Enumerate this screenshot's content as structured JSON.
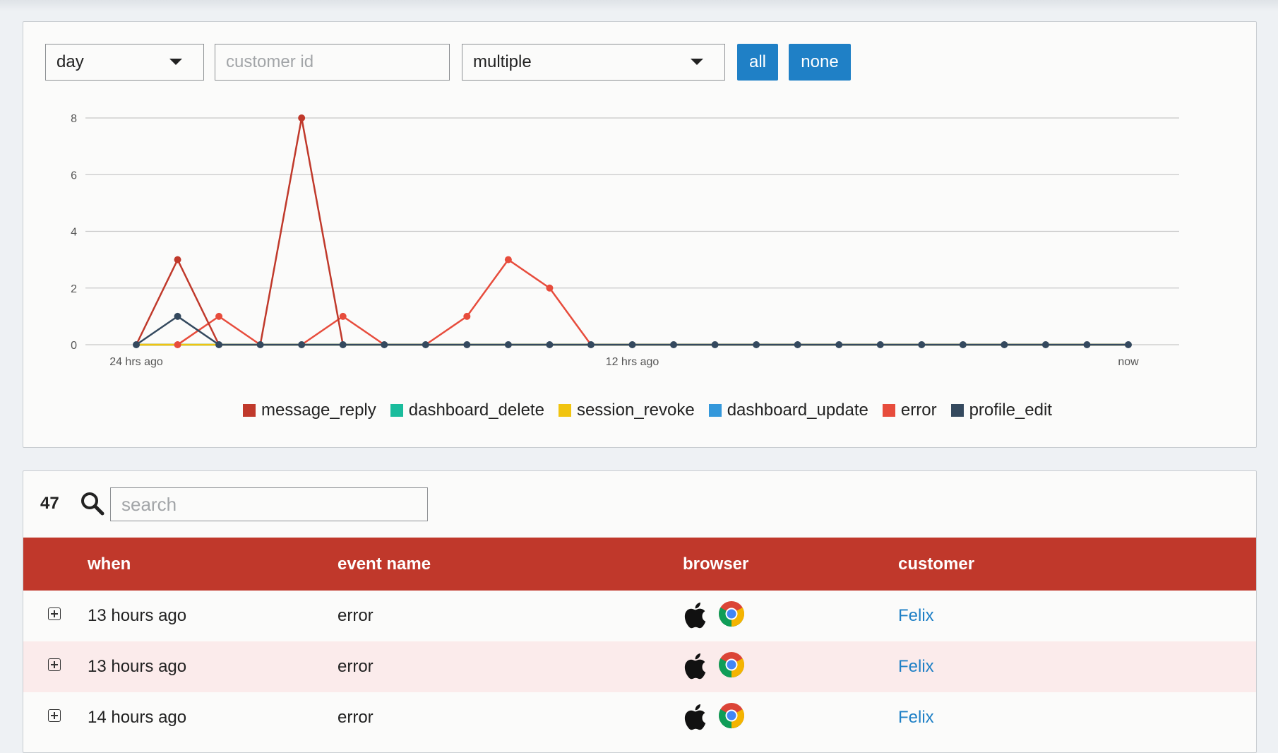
{
  "filters": {
    "period": "day",
    "customer_placeholder": "customer id",
    "events": "multiple",
    "all_label": "all",
    "none_label": "none"
  },
  "colors": {
    "message_reply": "#c0392b",
    "dashboard_delete": "#1abc9c",
    "session_revoke": "#f1c40f",
    "dashboard_update": "#3498db",
    "error": "#e74c3c",
    "profile_edit": "#34495e",
    "table_header": "#c0382b",
    "button": "#1f80c6"
  },
  "chart_data": {
    "type": "line",
    "x": [
      "24 hrs ago",
      "",
      "",
      "",
      "",
      "",
      "",
      "",
      "",
      "",
      "",
      "",
      "12 hrs ago",
      "",
      "",
      "",
      "",
      "",
      "",
      "",
      "",
      "",
      "",
      "",
      "now"
    ],
    "x_tick_labels": [
      "24 hrs ago",
      "12 hrs ago",
      "now"
    ],
    "y_ticks": [
      0,
      2,
      4,
      6,
      8
    ],
    "ylim": [
      0,
      8
    ],
    "grid": true,
    "legend_position": "bottom",
    "series": [
      {
        "name": "message_reply",
        "color": "#c0392b",
        "values": [
          0,
          3,
          0,
          0,
          8,
          0,
          0,
          0,
          0,
          0,
          0,
          0,
          0,
          0,
          0,
          0,
          0,
          0,
          0,
          0,
          0,
          0,
          0,
          0,
          0
        ]
      },
      {
        "name": "dashboard_delete",
        "color": "#1abc9c",
        "values": [
          0,
          0,
          0,
          0,
          0,
          0,
          0,
          0,
          0,
          0,
          0,
          0,
          0,
          0,
          0,
          0,
          0,
          0,
          0,
          0,
          0,
          0,
          0,
          0,
          0
        ]
      },
      {
        "name": "session_revoke",
        "color": "#f1c40f",
        "values": [
          0,
          0,
          0,
          0,
          0,
          0,
          0,
          0,
          0,
          0,
          0,
          0,
          0,
          0,
          0,
          0,
          0,
          0,
          0,
          0,
          0,
          0,
          0,
          0,
          0
        ]
      },
      {
        "name": "dashboard_update",
        "color": "#3498db",
        "values": [
          0,
          0,
          0,
          0,
          0,
          0,
          0,
          0,
          0,
          0,
          0,
          0,
          0,
          0,
          0,
          0,
          0,
          0,
          0,
          0,
          0,
          0,
          0,
          0,
          0
        ]
      },
      {
        "name": "error",
        "color": "#e74c3c",
        "values": [
          0,
          0,
          1,
          0,
          0,
          1,
          0,
          0,
          1,
          3,
          2,
          0,
          0,
          0,
          0,
          0,
          0,
          0,
          0,
          0,
          0,
          0,
          0,
          0,
          0
        ]
      },
      {
        "name": "profile_edit",
        "color": "#34495e",
        "values": [
          0,
          1,
          0,
          0,
          0,
          0,
          0,
          0,
          0,
          0,
          0,
          0,
          0,
          0,
          0,
          0,
          0,
          0,
          0,
          0,
          0,
          0,
          0,
          0,
          0
        ]
      }
    ]
  },
  "table": {
    "count": "47",
    "search_placeholder": "search",
    "headers": {
      "when": "when",
      "event_name": "event name",
      "browser": "browser",
      "customer": "customer"
    },
    "rows": [
      {
        "when": "13 hours ago",
        "event": "error",
        "os_icon": "apple-icon",
        "browser_icon": "chrome-icon",
        "customer": "Felix"
      },
      {
        "when": "13 hours ago",
        "event": "error",
        "os_icon": "apple-icon",
        "browser_icon": "chrome-icon",
        "customer": "Felix"
      },
      {
        "when": "14 hours ago",
        "event": "error",
        "os_icon": "apple-icon",
        "browser_icon": "chrome-icon",
        "customer": "Felix"
      }
    ]
  }
}
